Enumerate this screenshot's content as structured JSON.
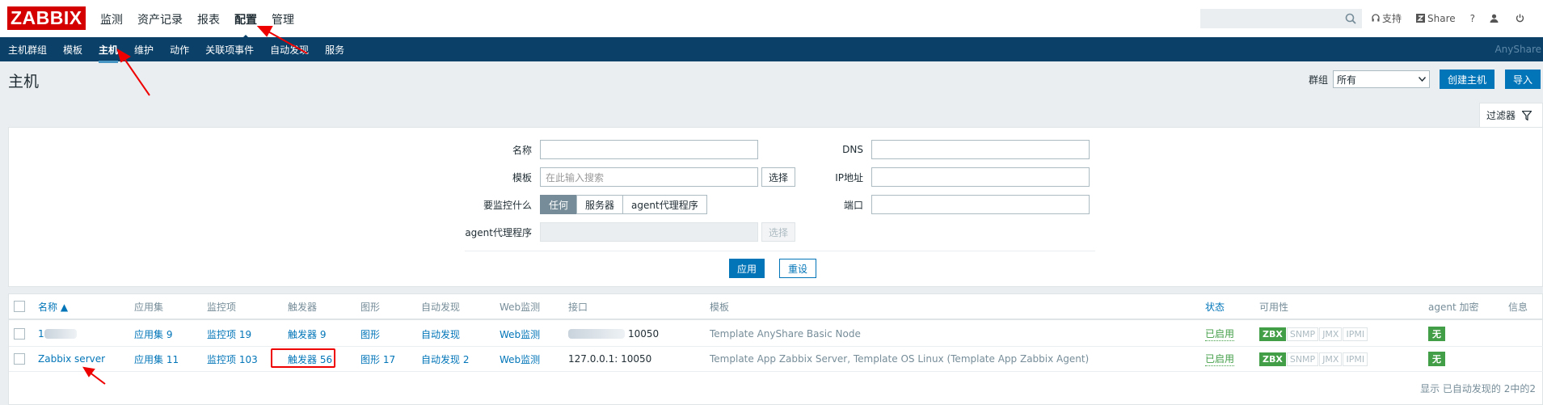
{
  "header": {
    "logo": "ZABBIX",
    "menu": [
      "监测",
      "资产记录",
      "报表",
      "配置",
      "管理"
    ],
    "active_menu": "配置",
    "support": "支持",
    "share": "Share",
    "help": "?"
  },
  "subnav": {
    "items": [
      "主机群组",
      "模板",
      "主机",
      "维护",
      "动作",
      "关联项事件",
      "自动发现",
      "服务"
    ],
    "active": "主机",
    "brand": "AnyShare"
  },
  "page": {
    "title": "主机",
    "group_label": "群组",
    "group_value": "所有",
    "create_button": "创建主机",
    "import_button": "导入"
  },
  "filter": {
    "tab_label": "过滤器",
    "name_label": "名称",
    "name_value": "",
    "template_label": "模板",
    "template_placeholder": "在此输入搜索",
    "select_label": "选择",
    "monitor_label": "要监控什么",
    "monitor_options": [
      "任何",
      "服务器",
      "agent代理程序"
    ],
    "monitor_selected": "任何",
    "proxy_label": "agent代理程序",
    "dns_label": "DNS",
    "ip_label": "IP地址",
    "port_label": "端口",
    "apply_button": "应用",
    "reset_button": "重设"
  },
  "table": {
    "headers": [
      "名称 ▲",
      "应用集",
      "监控项",
      "触发器",
      "图形",
      "自动发现",
      "Web监测",
      "接口",
      "模板",
      "状态",
      "可用性",
      "agent 加密",
      "信息"
    ],
    "rows": [
      {
        "name": "1",
        "apps": "应用集 9",
        "items": "监控项 19",
        "triggers": "触发器 9",
        "graphs": "图形",
        "discovery": "自动发现",
        "web": "Web监测",
        "interface": "10050",
        "templates": "Template AnyShare Basic Node",
        "status": "已启用",
        "availability": [
          "ZBX",
          "SNMP",
          "JMX",
          "IPMI"
        ],
        "encryption": "无"
      },
      {
        "name": "Zabbix server",
        "apps": "应用集 11",
        "items": "监控项 103",
        "triggers": "触发器 56",
        "graphs": "图形 17",
        "discovery": "自动发现 2",
        "web": "Web监测",
        "interface": "127.0.0.1: 10050",
        "templates": "Template App Zabbix Server, Template OS Linux (Template App Zabbix Agent)",
        "status": "已启用",
        "availability": [
          "ZBX",
          "SNMP",
          "JMX",
          "IPMI"
        ],
        "encryption": "无"
      }
    ],
    "footer": "显示 已自动发现的 2中的2"
  }
}
